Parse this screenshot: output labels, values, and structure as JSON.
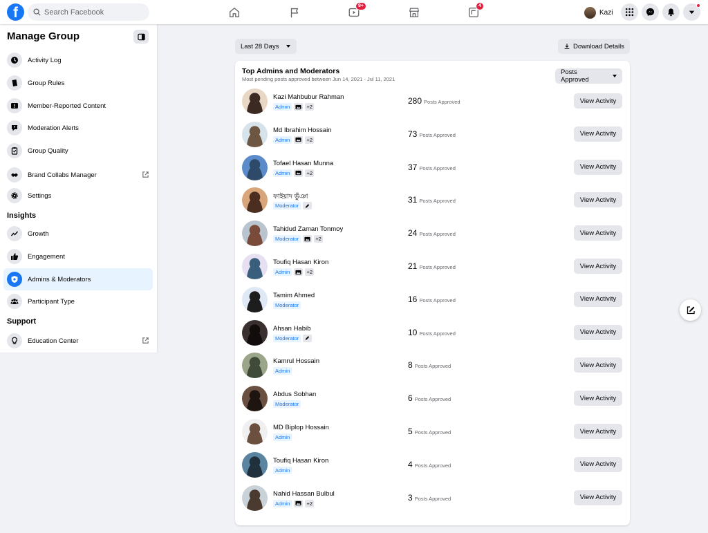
{
  "topbar": {
    "logo_letter": "f",
    "search_placeholder": "Search Facebook",
    "video_badge": "9+",
    "gaming_badge": "4",
    "profile_name": "Kazi"
  },
  "sidebar": {
    "title": "Manage Group",
    "items": [
      {
        "label": "Activity Log",
        "icon": "clock-icon"
      },
      {
        "label": "Group Rules",
        "icon": "book-icon"
      },
      {
        "label": "Member-Reported Content",
        "icon": "report-icon"
      },
      {
        "label": "Moderation Alerts",
        "icon": "alert-bubble-icon"
      },
      {
        "label": "Group Quality",
        "icon": "clipboard-icon"
      },
      {
        "label": "Brand Collabs Manager",
        "icon": "handshake-icon"
      },
      {
        "label": "Settings",
        "icon": "gear-icon"
      }
    ],
    "insights_heading": "Insights",
    "insight_items": [
      {
        "label": "Growth",
        "icon": "trend-icon"
      },
      {
        "label": "Engagement",
        "icon": "thumbs-up-icon"
      },
      {
        "label": "Admins & Moderators",
        "icon": "shield-icon"
      },
      {
        "label": "Participant Type",
        "icon": "people-icon"
      }
    ],
    "support_heading": "Support",
    "support_items": [
      {
        "label": "Education Center",
        "icon": "lightbulb-icon"
      }
    ]
  },
  "controls": {
    "date_range": "Last 28 Days",
    "download": "Download Details"
  },
  "card": {
    "title": "Top Admins and Moderators",
    "subtitle": "Most pending posts approved between Jun 14, 2021 - Jul 11, 2021",
    "sort_label": "Posts Approved",
    "count_label": "Posts Approved",
    "button_label": "View Activity",
    "rows": [
      {
        "name": "Kazi Mahbubur Rahman",
        "role": "Admin",
        "extra": "+2",
        "count": "280",
        "mod_icon": false
      },
      {
        "name": "Md Ibrahim Hossain",
        "role": "Admin",
        "extra": "+2",
        "count": "73",
        "mod_icon": false
      },
      {
        "name": "Tofael Hasan Munna",
        "role": "Admin",
        "extra": "+2",
        "count": "37",
        "mod_icon": false
      },
      {
        "name": "ফাইয়াদ ভুঁঞা",
        "role": "Moderator",
        "extra": "",
        "count": "31",
        "mod_icon": true
      },
      {
        "name": "Tahidud Zaman Tonmoy",
        "role": "Moderator",
        "extra": "+2",
        "count": "24",
        "mod_icon": false
      },
      {
        "name": "Toufiq Hasan Kiron",
        "role": "Admin",
        "extra": "+2",
        "count": "21",
        "mod_icon": false
      },
      {
        "name": "Tamim Ahmed",
        "role": "Moderator",
        "extra": "",
        "count": "16",
        "mod_icon": false
      },
      {
        "name": "Ahsan Habib",
        "role": "Moderator",
        "extra": "",
        "count": "10",
        "mod_icon": true
      },
      {
        "name": "Kamrul Hossain",
        "role": "Admin",
        "extra": "",
        "count": "8",
        "mod_icon": false
      },
      {
        "name": "Abdus Sobhan",
        "role": "Moderator",
        "extra": "",
        "count": "6",
        "mod_icon": false
      },
      {
        "name": "MD Biplop Hossain",
        "role": "Admin",
        "extra": "",
        "count": "5",
        "mod_icon": false
      },
      {
        "name": "Toufiq Hasan Kiron",
        "role": "Admin",
        "extra": "",
        "count": "4",
        "mod_icon": false
      },
      {
        "name": "Nahid Hassan Bulbul",
        "role": "Admin",
        "extra": "+2",
        "count": "3",
        "mod_icon": false
      }
    ]
  },
  "colors": {
    "brand_blue": "#1877f2",
    "badge_red": "#e41e3f",
    "active_bg": "#e7f3ff"
  }
}
